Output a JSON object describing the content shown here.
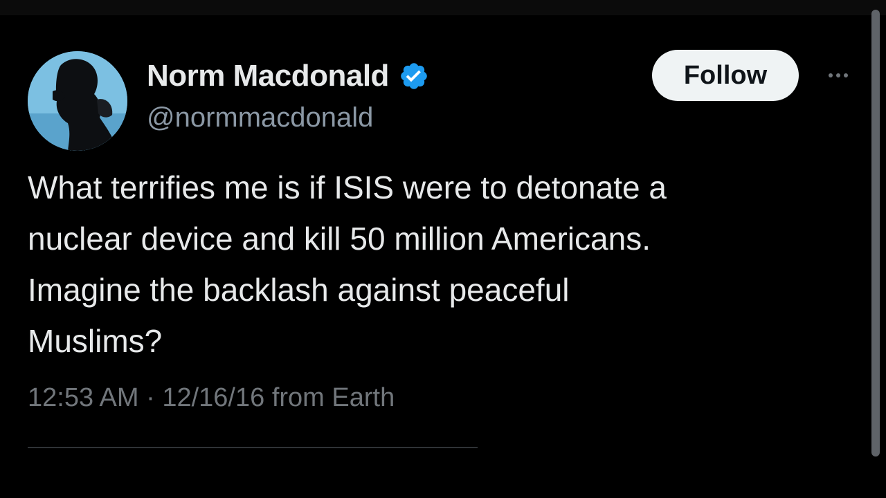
{
  "tweet": {
    "author": {
      "display_name": "Norm Macdonald",
      "handle": "@normmacdonald",
      "verified": true,
      "avatar_icon": "avatar-silhouette"
    },
    "follow_label": "Follow",
    "more_icon": "more-horizontal-icon",
    "text_lines": [
      "What terrifies me is if ISIS were to detonate a",
      "nuclear device and kill 50 million Americans.",
      "Imagine the backlash against peaceful",
      "Muslims?"
    ],
    "time": "12:53 AM",
    "separator": "·",
    "date": "12/16/16",
    "source": "from Earth"
  },
  "colors": {
    "background": "#000000",
    "primary_text": "#e7e9ea",
    "secondary_text": "#8b98a5",
    "verified_blue": "#1d9bf0",
    "follow_button_bg": "#eff3f4"
  }
}
